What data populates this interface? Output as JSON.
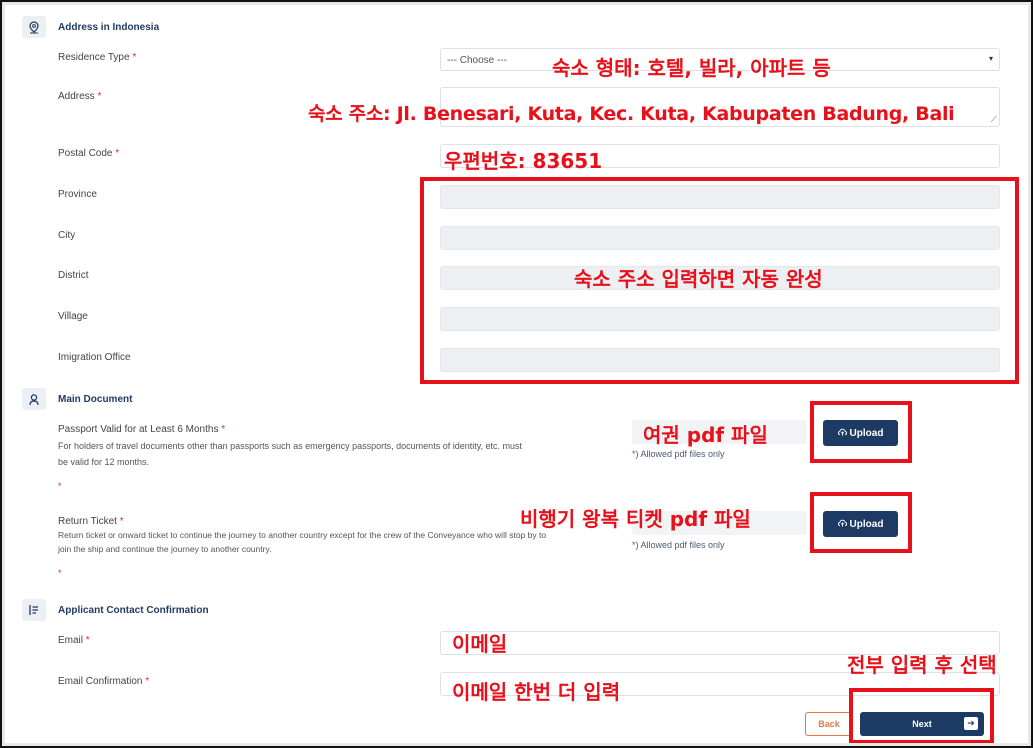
{
  "sections": {
    "address": "Address in Indonesia",
    "main_document": "Main Document",
    "contact": "Applicant Contact Confirmation"
  },
  "fields": {
    "residence_type": "Residence Type",
    "residence_type_placeholder": "--- Choose ---",
    "address": "Address",
    "postal_code": "Postal Code",
    "province": "Province",
    "city": "City",
    "district": "District",
    "village": "Village",
    "imigration_office": "Imigration Office",
    "email": "Email",
    "email_confirmation": "Email Confirmation",
    "required_marker": "*"
  },
  "documents": {
    "passport_title": "Passport Valid for at Least 6 Months",
    "passport_desc_1": "For holders of travel documents other than passports such as emergency passports, documents of identity, etc. must",
    "passport_desc_2": "be valid for 12 months.",
    "ticket_title": "Return Ticket",
    "ticket_desc_1": "Return ticket or onward ticket to continue the journey to another country except for the crew of the Conveyance who will stop by to",
    "ticket_desc_2": "join the ship and continue the journey to another country.",
    "upload_label": "Upload",
    "allowed_note": "*) Allowed pdf files only"
  },
  "buttons": {
    "back": "Back",
    "next": "Next"
  },
  "annotations": {
    "residence": "숙소 형태: 호텔, 빌라, 아파트 등",
    "address": "숙소 주소: Jl. Benesari, Kuta, Kec. Kuta, Kabupaten Badung, Bali",
    "postal": "우편번호: 83651",
    "autofill": "숙소 주소 입력하면 자동 완성",
    "passport": "여권 pdf 파일",
    "ticket": "비행기 왕복 티켓 pdf 파일",
    "email": "이메일",
    "email_again": "이메일 한번 더 입력",
    "submit": "전부 입력 후 선택"
  },
  "colors": {
    "primary": "#1c3a63",
    "annotation": "#e8101a",
    "back_accent": "#e07a3f",
    "required": "#d93025"
  }
}
